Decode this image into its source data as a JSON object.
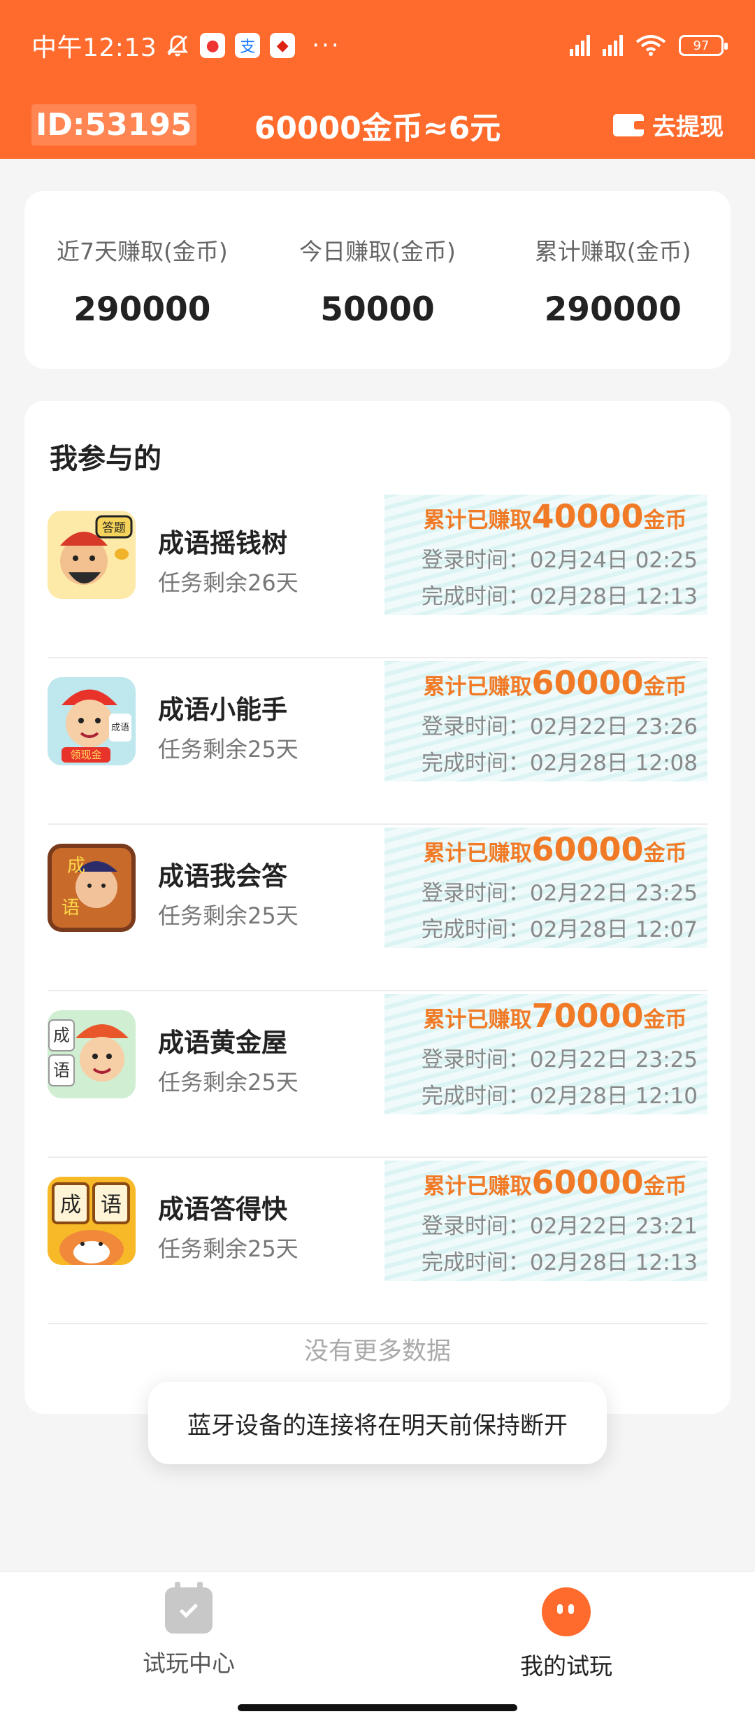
{
  "status_bar": {
    "time": "中午12:13",
    "battery": "97"
  },
  "header": {
    "user_id": "ID:53195",
    "coin_rate": "60000金币≈6元",
    "withdraw_label": "去提现"
  },
  "stats": [
    {
      "label": "近7天赚取(金币)",
      "value": "290000"
    },
    {
      "label": "今日赚取(金币)",
      "value": "50000"
    },
    {
      "label": "累计赚取(金币)",
      "value": "290000"
    }
  ],
  "list": {
    "title": "我参与的",
    "earn_prefix": "累计已赚取",
    "earn_suffix": "金币",
    "items": [
      {
        "name": "成语摇钱树",
        "remain": "任务剩余26天",
        "amount": "40000",
        "login": "登录时间：02月24日 02:25",
        "done": "完成时间：02月28日 12:13"
      },
      {
        "name": "成语小能手",
        "remain": "任务剩余25天",
        "amount": "60000",
        "login": "登录时间：02月22日 23:26",
        "done": "完成时间：02月28日 12:08"
      },
      {
        "name": "成语我会答",
        "remain": "任务剩余25天",
        "amount": "60000",
        "login": "登录时间：02月22日 23:25",
        "done": "完成时间：02月28日 12:07"
      },
      {
        "name": "成语黄金屋",
        "remain": "任务剩余25天",
        "amount": "70000",
        "login": "登录时间：02月22日 23:25",
        "done": "完成时间：02月28日 12:10"
      },
      {
        "name": "成语答得快",
        "remain": "任务剩余25天",
        "amount": "60000",
        "login": "登录时间：02月22日 23:21",
        "done": "完成时间：02月28日 12:13"
      }
    ],
    "no_more": "没有更多数据"
  },
  "toast": "蓝牙设备的连接将在明天前保持断开",
  "nav": {
    "left_label": "试玩中心",
    "right_label": "我的试玩"
  },
  "colors": {
    "brand": "#ff6b2d",
    "earn": "#f07a26"
  }
}
